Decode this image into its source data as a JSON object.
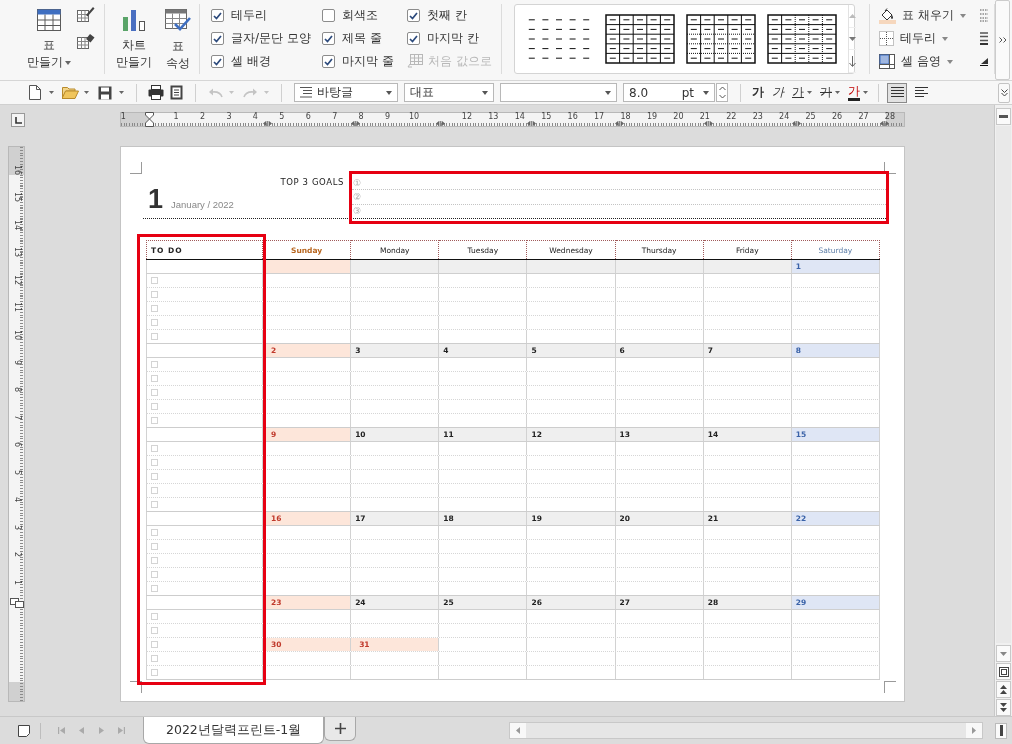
{
  "ribbon": {
    "create_table": {
      "lines": [
        "표",
        "만들기"
      ]
    },
    "create_chart": {
      "lines": [
        "차트",
        "만들기"
      ]
    },
    "table_properties": {
      "lines": [
        "표",
        "속성"
      ]
    },
    "options": [
      {
        "label": "테두리",
        "checked": true
      },
      {
        "label": "글자/문단 모양",
        "checked": true
      },
      {
        "label": "셀 배경",
        "checked": true
      },
      {
        "label": "회색조",
        "checked": false
      },
      {
        "label": "제목 줄",
        "checked": true
      },
      {
        "label": "마지막 줄",
        "checked": true
      },
      {
        "label": "첫째 칸",
        "checked": true
      },
      {
        "label": "마지막 칸",
        "checked": true
      }
    ],
    "reset_button": {
      "label": "처음 값으로",
      "disabled": true
    },
    "cell_tools": [
      {
        "label": "표 채우기"
      },
      {
        "label": "테두리"
      },
      {
        "label": "셀 음영"
      }
    ]
  },
  "toolbar": {
    "undo": {
      "disabled": true
    },
    "redo": {
      "disabled": true
    },
    "style": "바탕글",
    "language": "대표",
    "size": "8.0",
    "unit": "pt",
    "format_buttons": [
      {
        "label": "가",
        "kind": "bold"
      },
      {
        "label": "가",
        "kind": "italic"
      },
      {
        "label": "가",
        "kind": "underline"
      },
      {
        "label": "가",
        "kind": "strikethrough"
      },
      {
        "label": "가",
        "kind": "color"
      }
    ],
    "alignment": [
      {
        "selected": true
      },
      {
        "selected": false
      }
    ]
  },
  "ruler": {
    "horizontal": [
      {
        "kind": "number",
        "label": "1"
      },
      {
        "kind": "indent-marker"
      },
      {
        "kind": "number",
        "label": "1"
      },
      {
        "kind": "number",
        "label": "2"
      },
      {
        "kind": "number",
        "label": "3"
      },
      {
        "kind": "number",
        "label": "4"
      },
      {
        "kind": "number",
        "label": "5"
      },
      {
        "kind": "number",
        "label": "6"
      },
      {
        "kind": "number",
        "label": "7"
      },
      {
        "kind": "number",
        "label": "8"
      },
      {
        "kind": "number",
        "label": "9"
      },
      {
        "kind": "number",
        "label": "10"
      },
      {
        "kind": "column-marker"
      },
      {
        "kind": "number",
        "label": "12"
      },
      {
        "kind": "number",
        "label": "13"
      },
      {
        "kind": "number",
        "label": "14"
      },
      {
        "kind": "number",
        "label": "15"
      },
      {
        "kind": "number",
        "label": "16"
      },
      {
        "kind": "number",
        "label": "17"
      },
      {
        "kind": "number",
        "label": "18"
      },
      {
        "kind": "number",
        "label": "19"
      },
      {
        "kind": "number",
        "label": "20"
      },
      {
        "kind": "number",
        "label": "21"
      },
      {
        "kind": "number",
        "label": "22"
      },
      {
        "kind": "number",
        "label": "23"
      },
      {
        "kind": "number",
        "label": "24"
      },
      {
        "kind": "number",
        "label": "25"
      },
      {
        "kind": "number",
        "label": "26"
      },
      {
        "kind": "number",
        "label": "27"
      },
      {
        "kind": "number",
        "label": "28"
      }
    ],
    "vertical": [
      "16",
      "15",
      "14",
      "13",
      "12",
      "11",
      "10",
      "9",
      "8",
      "7",
      "6",
      "5",
      "4",
      "3",
      "2",
      "1"
    ]
  },
  "document": {
    "month_number": "1",
    "month_year": "January / 2022",
    "goals_title": "TOP 3 GOALS",
    "goals": [
      "①",
      "②",
      "③"
    ],
    "goals_highlighted": true,
    "calendar": {
      "todo_heading": "TO DO",
      "todo_highlighted": true,
      "days": [
        {
          "name": "Sunday",
          "kind": "sunday"
        },
        {
          "name": "Monday",
          "kind": "weekday"
        },
        {
          "name": "Tuesday",
          "kind": "weekday"
        },
        {
          "name": "Wednesday",
          "kind": "weekday"
        },
        {
          "name": "Thursday",
          "kind": "weekday"
        },
        {
          "name": "Friday",
          "kind": "weekday"
        },
        {
          "name": "Saturday",
          "kind": "saturday"
        }
      ],
      "weeks": [
        {
          "dates": [
            "1"
          ],
          "todo": [
            {
              "checked": false
            },
            {
              "checked": false
            },
            {
              "checked": false
            },
            {
              "checked": false
            },
            {
              "checked": false
            }
          ]
        },
        {
          "dates": [
            "2",
            "3",
            "4",
            "5",
            "6",
            "7",
            "8"
          ],
          "todo": [
            {
              "checked": false
            },
            {
              "checked": false
            },
            {
              "checked": false
            },
            {
              "checked": false
            },
            {
              "checked": false
            }
          ]
        },
        {
          "dates": [
            "9",
            "10",
            "11",
            "12",
            "13",
            "14",
            "15"
          ],
          "todo": [
            {
              "checked": false
            },
            {
              "checked": false
            },
            {
              "checked": false
            },
            {
              "checked": false
            },
            {
              "checked": false
            }
          ]
        },
        {
          "dates": [
            "16",
            "17",
            "18",
            "19",
            "20",
            "21",
            "22"
          ],
          "todo": [
            {
              "checked": false
            },
            {
              "checked": false
            },
            {
              "checked": false
            },
            {
              "checked": false
            },
            {
              "checked": false
            }
          ]
        },
        {
          "dates": [
            "23",
            "24",
            "25",
            "26",
            "27",
            "28",
            "29"
          ],
          "todo": [
            {
              "checked": false
            },
            {
              "checked": false
            },
            {
              "checked": false
            },
            {
              "checked": false
            },
            {
              "checked": false
            }
          ]
        }
      ],
      "overflow_dates": [
        {
          "date": "30",
          "kind": "sunday"
        },
        {
          "date": "31",
          "kind": "sunday"
        }
      ]
    }
  },
  "sheet_navigation": [
    {
      "disabled": true
    },
    {
      "disabled": true
    },
    {
      "disabled": true
    },
    {
      "disabled": true
    }
  ],
  "sheet_tabs": [
    {
      "label": "2022년달력프린트-1월",
      "selected": true
    }
  ]
}
